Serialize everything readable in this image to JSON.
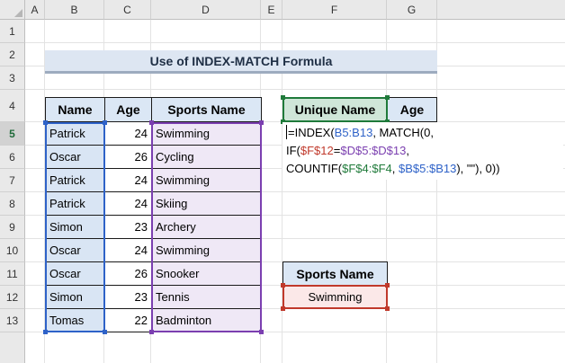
{
  "columns": [
    "A",
    "B",
    "C",
    "D",
    "E",
    "F",
    "G"
  ],
  "rows": [
    "1",
    "2",
    "3",
    "4",
    "5",
    "6",
    "7",
    "8",
    "9",
    "10",
    "11",
    "12",
    "13"
  ],
  "title": "Use of INDEX-MATCH Formula",
  "table": {
    "headers": [
      "Name",
      "Age",
      "Sports Name"
    ],
    "rows": [
      {
        "name": "Patrick",
        "age": "24",
        "sport": "Swimming"
      },
      {
        "name": "Oscar",
        "age": "26",
        "sport": "Cycling"
      },
      {
        "name": "Patrick",
        "age": "24",
        "sport": "Swimming"
      },
      {
        "name": "Patrick",
        "age": "24",
        "sport": "Skiing"
      },
      {
        "name": "Simon",
        "age": "23",
        "sport": "Archery"
      },
      {
        "name": "Oscar",
        "age": "24",
        "sport": "Swimming"
      },
      {
        "name": "Oscar",
        "age": "26",
        "sport": "Snooker"
      },
      {
        "name": "Simon",
        "age": "23",
        "sport": "Tennis"
      },
      {
        "name": "Tomas",
        "age": "22",
        "sport": "Badminton"
      }
    ]
  },
  "unique": {
    "header_name": "Unique Name",
    "header_age": "Age"
  },
  "formula": {
    "p1": "=INDEX(",
    "p2": "B5:B13",
    "p3": ", MATCH(0, IF(",
    "p4": "$F$12",
    "p5": "=",
    "p6": "$D$5:$D$13",
    "p7": ",",
    "p8": "COUNTIF(",
    "p9": "$F$4:$F4",
    "p10": ", ",
    "p11": "$B$5:$B13",
    "p12": "), \"\"), 0))"
  },
  "lookup": {
    "header": "Sports Name",
    "value": "Swimming"
  },
  "colors": {
    "blue_range": "#2e62c8",
    "purple_range": "#7b3fb0",
    "green_range": "#1f7a3a",
    "red_range": "#c0392b"
  }
}
